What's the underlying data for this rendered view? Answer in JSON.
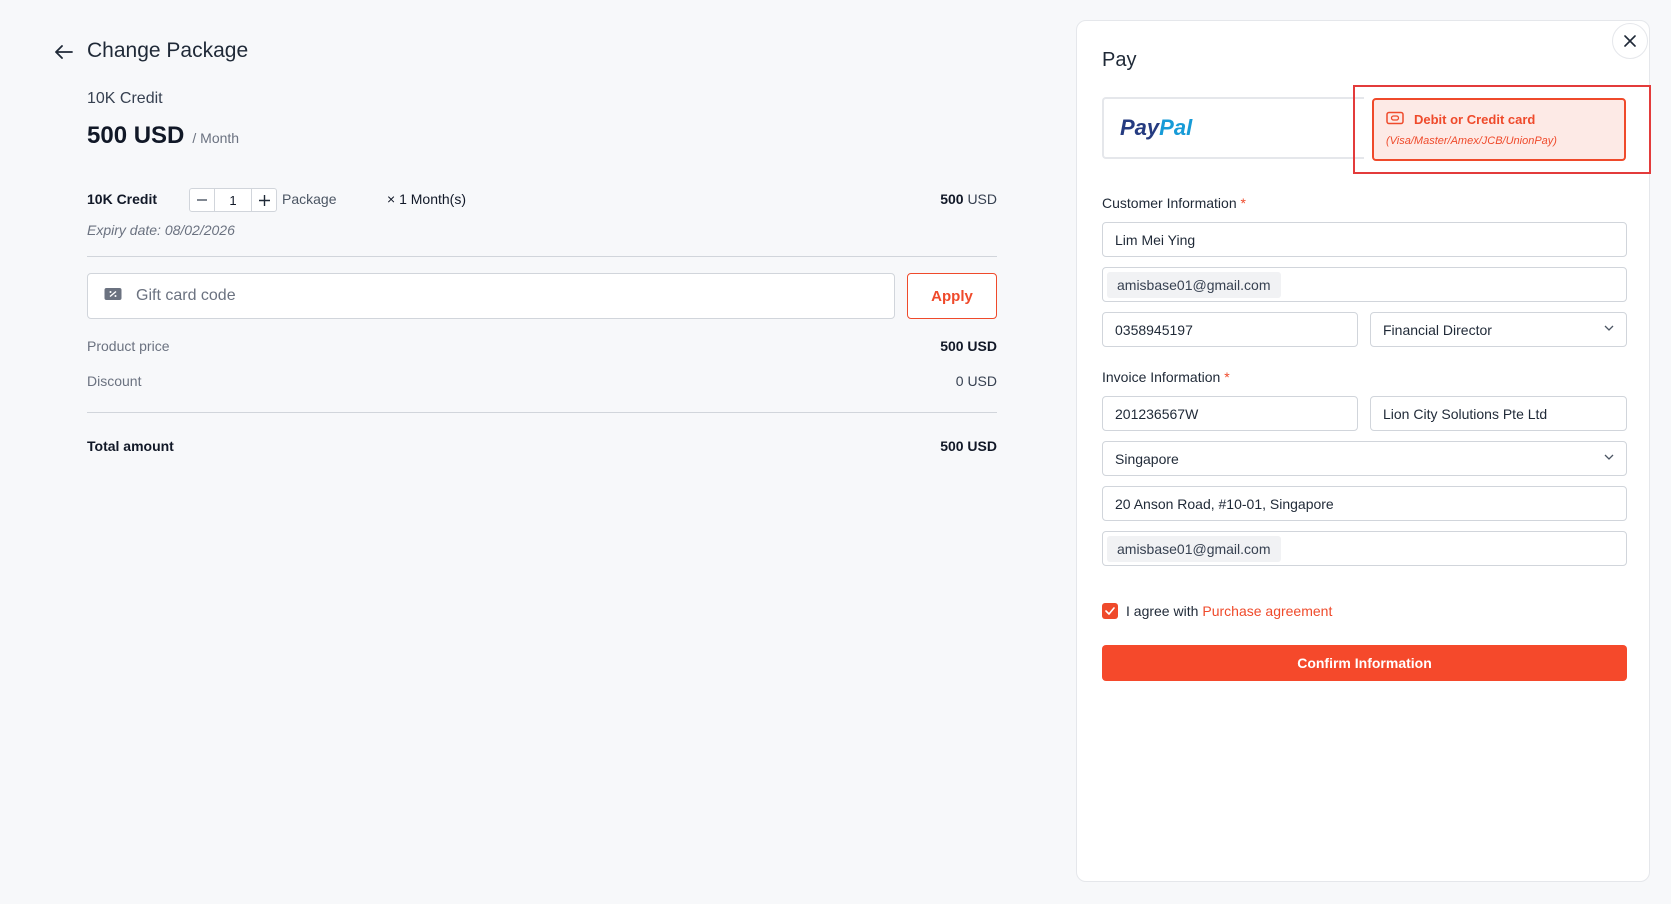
{
  "header": {
    "title": "Change Package"
  },
  "package": {
    "name": "10K Credit",
    "price": "500 USD",
    "period": "/ Month"
  },
  "line_item": {
    "name": "10K Credit",
    "quantity": "1",
    "unit": "Package",
    "duration": "× 1 Month(s)",
    "amount": "500",
    "currency": "USD",
    "expiry": "Expiry date: 08/02/2026"
  },
  "gift_card": {
    "placeholder": "Gift card code",
    "apply_label": "Apply"
  },
  "summary": {
    "product_price_label": "Product price",
    "product_price_value": "500 USD",
    "discount_label": "Discount",
    "discount_value": "0 USD",
    "total_label": "Total amount",
    "total_value": "500 USD"
  },
  "pay": {
    "title": "Pay",
    "paypal_part1": "Pay",
    "paypal_part2": "Pal",
    "card_title": "Debit or Credit card",
    "card_subtitle": "(Visa/Master/Amex/JCB/UnionPay)",
    "customer_label": "Customer Information",
    "required_mark": "*",
    "customer_name": "Lim Mei Ying",
    "customer_email": "amisbase01@gmail.com",
    "customer_phone": "0358945197",
    "customer_position": "Financial Director",
    "invoice_label": "Invoice Information",
    "tax_code": "201236567W",
    "company_name": "Lion City Solutions Pte Ltd",
    "country": "Singapore",
    "address": "20 Anson Road, #10-01, Singapore",
    "invoice_email": "amisbase01@gmail.com",
    "agree_text": "I agree with",
    "agreement_link": "Purchase agreement",
    "confirm_label": "Confirm Information"
  },
  "colors": {
    "accent": "#ef4a2b",
    "highlight_box": "#e33b3b",
    "paypal_dark": "#253b80",
    "paypal_light": "#179bd7"
  }
}
